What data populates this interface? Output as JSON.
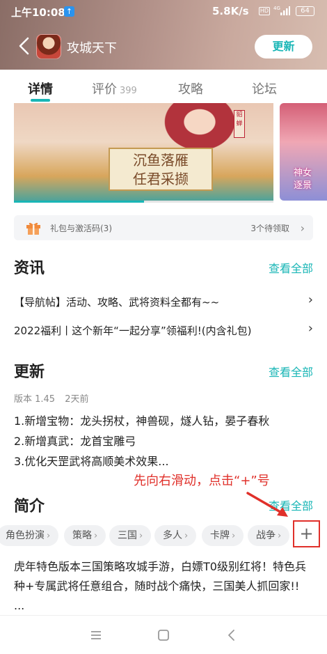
{
  "statusbar": {
    "time": "上午10:08",
    "upload_glyph": "↑",
    "speed": "5.8K/s",
    "hd": "HD",
    "signal": "4G",
    "battery": "64"
  },
  "header": {
    "title": "攻城天下",
    "update_label": "更新",
    "accent": "#19b6b6"
  },
  "tabs": [
    {
      "label": "详情",
      "active": true
    },
    {
      "label": "评价",
      "count": "399"
    },
    {
      "label": "攻略"
    },
    {
      "label": "论坛"
    }
  ],
  "banner": {
    "sign_line1": "沉鱼落雁",
    "sign_line2": "任君采撷",
    "stamp": "貂蝉",
    "side_line1": "神女",
    "side_line2": "逐景",
    "carousel_progress": 0.5
  },
  "gift": {
    "label": "礼包与激活码(3)",
    "status": "3个待领取"
  },
  "news": {
    "title": "资讯",
    "see_all": "查看全部",
    "items": [
      "【导航帖】活动、攻略、武将资料全都有~~",
      "2022福利丨这个新年“一起分享”领福利!(内含礼包)"
    ]
  },
  "updates": {
    "title": "更新",
    "see_all": "查看全部",
    "version": "版本 1.45",
    "date": "2天前",
    "lines": [
      "1.新增宝物：龙头拐杖，神兽砚，燧人钻，晏子春秋",
      "2.新增真武：龙首宝雕弓",
      "3.优化天罡武将高顺美术效果..."
    ]
  },
  "intro": {
    "title": "简介",
    "see_all": "查看全部",
    "annotation": "先向右滑动，点击“+”号",
    "tags": [
      "角色扮演",
      "策略",
      "三国",
      "多人",
      "卡牌",
      "战争"
    ],
    "plus": "+",
    "text": "虎年特色版本三国策略攻城手游，白嫖T0级别红将！特色兵种+专属武将任意组合，随时战个痛快，三国美人抓回家!! ..."
  },
  "colors": {
    "annotation": "#e0302a",
    "accent": "#19b6b6"
  }
}
